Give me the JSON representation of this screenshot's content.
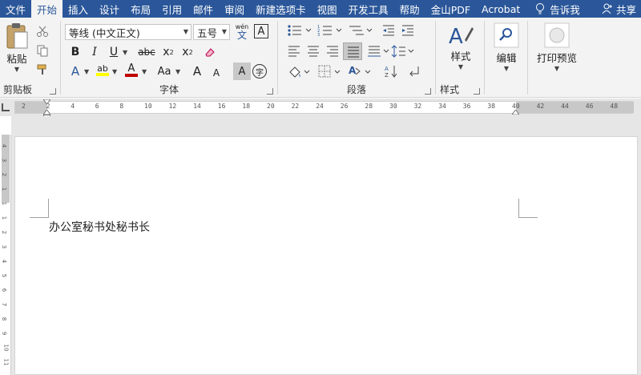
{
  "tabs": [
    {
      "label": "文件",
      "active": false
    },
    {
      "label": "开始",
      "active": true
    },
    {
      "label": "插入",
      "active": false
    },
    {
      "label": "设计",
      "active": false
    },
    {
      "label": "布局",
      "active": false
    },
    {
      "label": "引用",
      "active": false
    },
    {
      "label": "邮件",
      "active": false
    },
    {
      "label": "审阅",
      "active": false
    },
    {
      "label": "新建选项卡",
      "active": false
    },
    {
      "label": "视图",
      "active": false
    },
    {
      "label": "开发工具",
      "active": false
    },
    {
      "label": "帮助",
      "active": false
    },
    {
      "label": "金山PDF",
      "active": false
    },
    {
      "label": "Acrobat",
      "active": false
    }
  ],
  "tell_me": {
    "label": "告诉我",
    "icon": "lightbulb-icon"
  },
  "share": {
    "label": "共享",
    "icon": "person-icon"
  },
  "clipboard": {
    "group_label": "剪贴板",
    "paste_label": "粘贴",
    "icons": [
      "clipboard-icon",
      "scissors-icon",
      "copy-icon",
      "format-painter-icon"
    ]
  },
  "font": {
    "group_label": "字体",
    "font_name": "等线 (中文正文)",
    "font_size": "五号",
    "phonetic_top": "wén",
    "phonetic_bottom": "文",
    "char_border": "A",
    "bold": "B",
    "italic": "I",
    "underline": "U",
    "strikethrough": "abc",
    "subscript": "x",
    "subscript_mark": "2",
    "superscript": "x",
    "superscript_mark": "2",
    "text_effects": "A",
    "highlight": "ab",
    "font_color": "A",
    "change_case": "Aa",
    "grow": "A",
    "shrink": "A",
    "char_shading": "A",
    "enclose": "字",
    "colors": {
      "highlight": "#ffff00",
      "font_color": "#c00000",
      "accent": "#2b579a"
    }
  },
  "paragraph": {
    "group_label": "段落"
  },
  "styles": {
    "group_label": "样式",
    "button_label": "样式"
  },
  "editing": {
    "button_label": "编辑"
  },
  "print_preview": {
    "button_label": "打印预览"
  },
  "ruler": {
    "ticks": [
      "2",
      "2",
      "4",
      "6",
      "8",
      "10",
      "12",
      "14",
      "16",
      "18",
      "20",
      "22",
      "24",
      "26",
      "28",
      "30",
      "32",
      "34",
      "36",
      "38",
      "40",
      "42",
      "44",
      "46",
      "48"
    ]
  },
  "vruler": {
    "ticks": [
      "4",
      "3",
      "2",
      "1",
      "1",
      "1",
      "2",
      "3",
      "4",
      "5",
      "6",
      "7",
      "8",
      "9",
      "10",
      "11"
    ]
  },
  "document": {
    "text": "办公室秘书处秘书长"
  }
}
